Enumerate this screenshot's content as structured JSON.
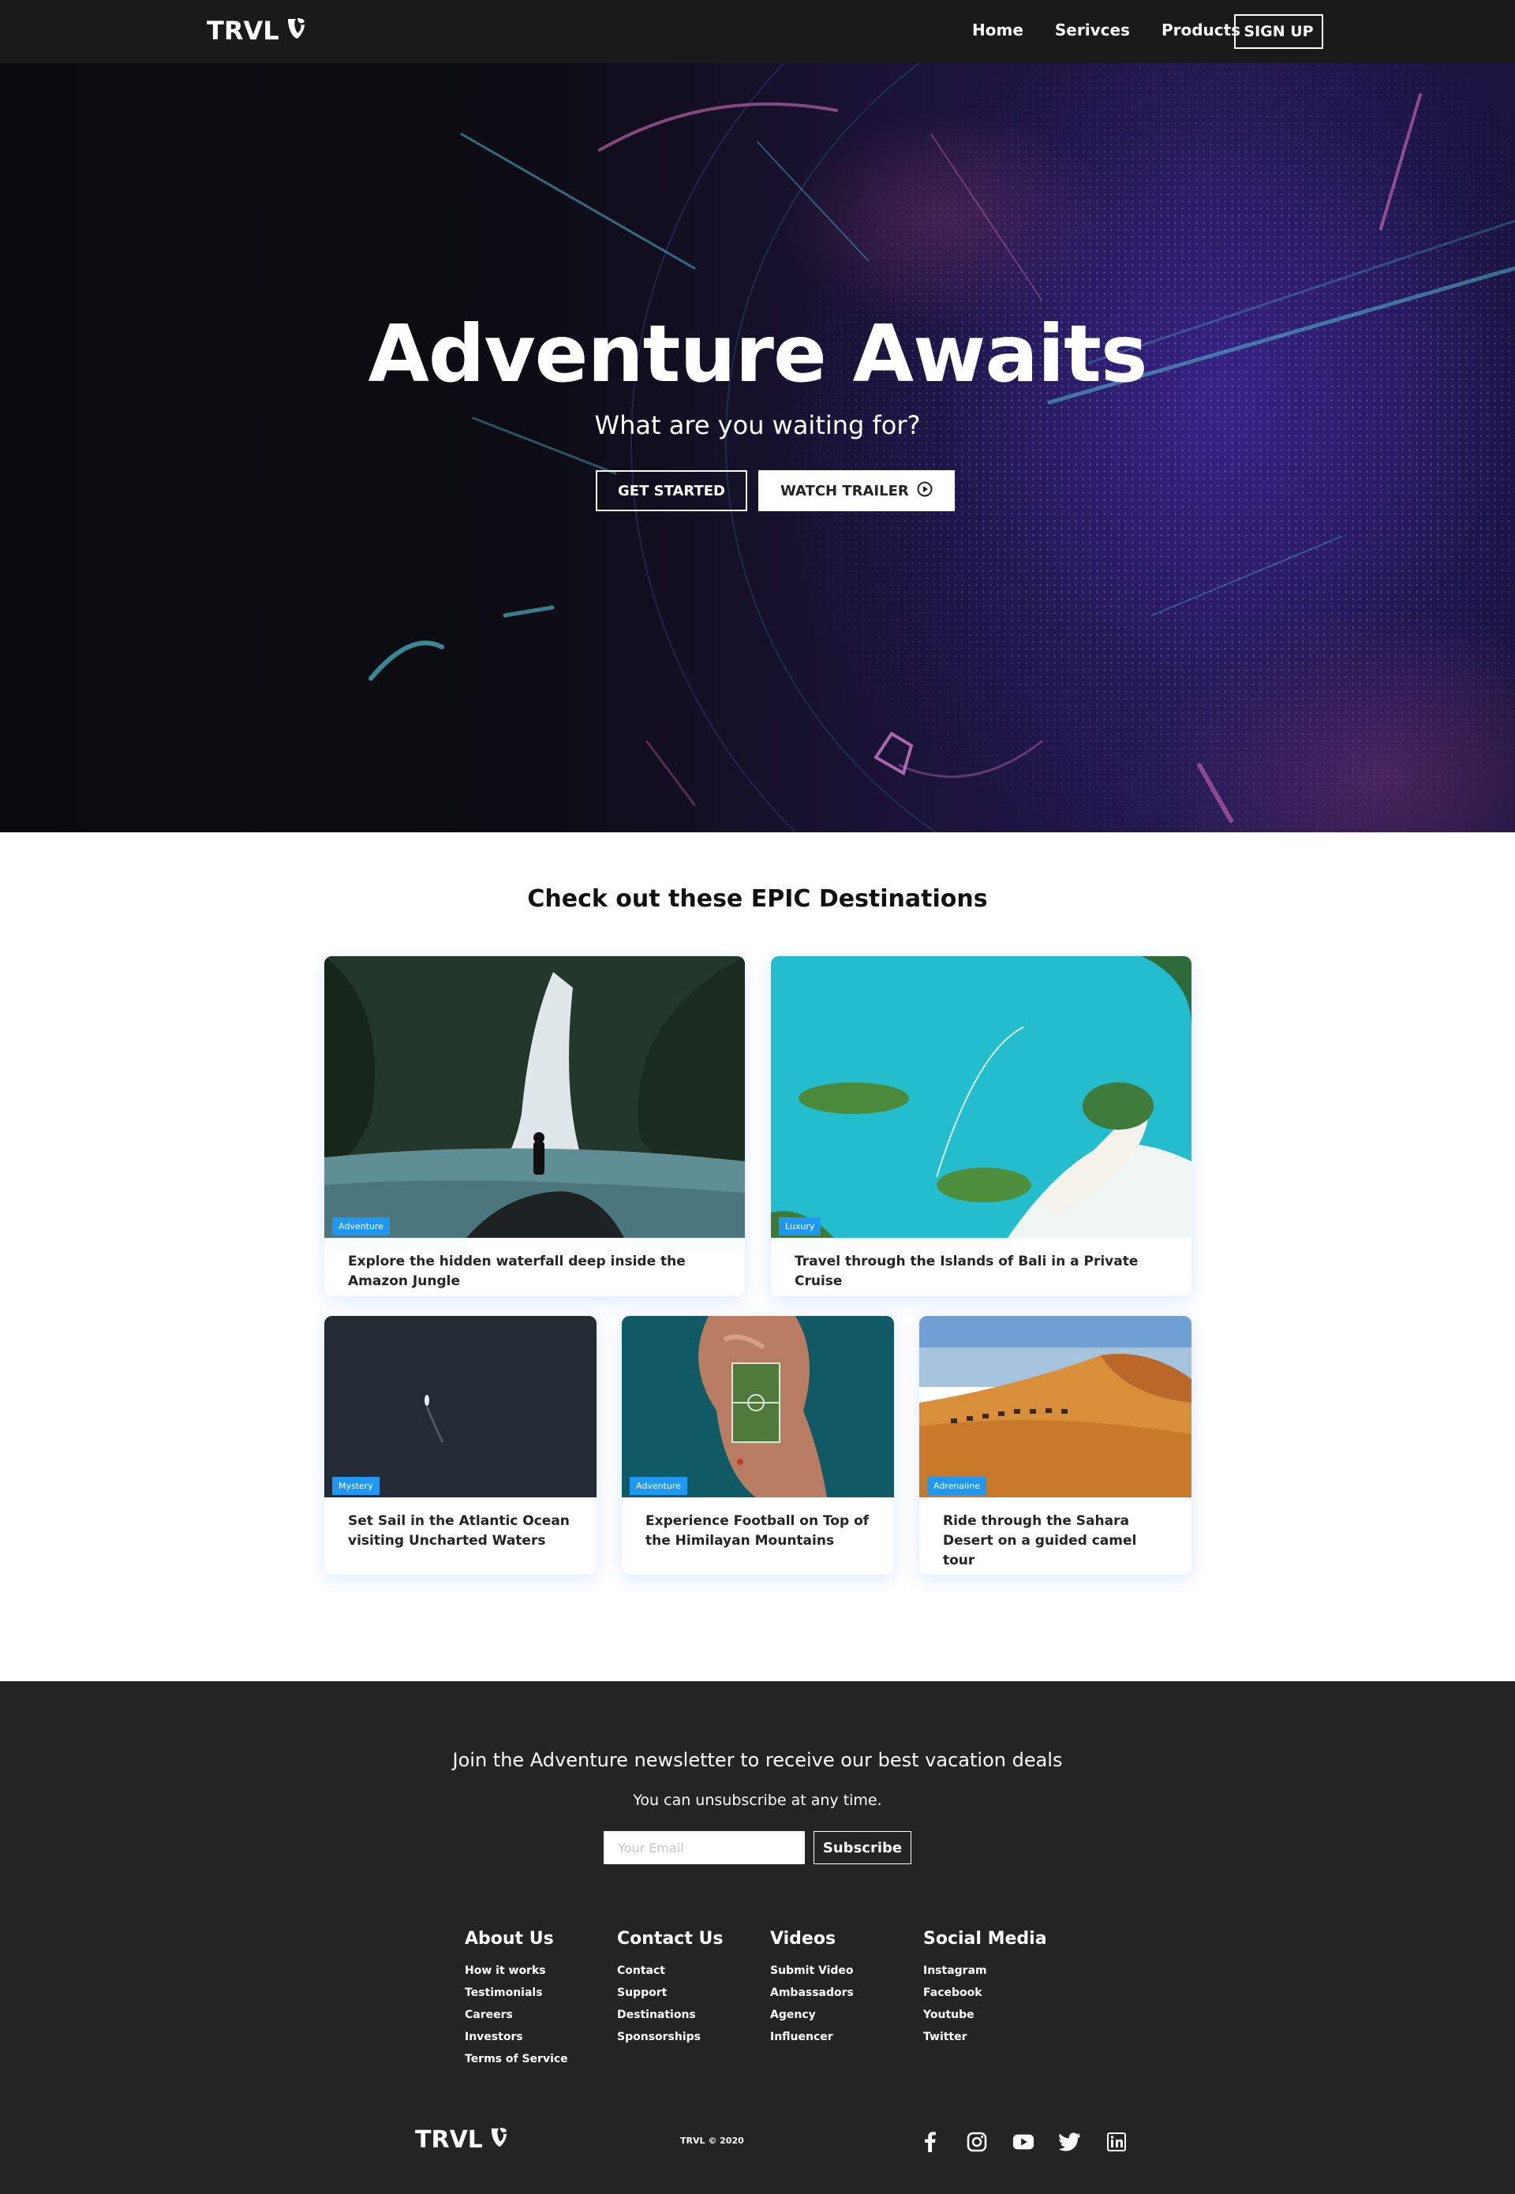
{
  "brand": {
    "name": "TRVL"
  },
  "nav": {
    "links": [
      "Home",
      "Serivces",
      "Products"
    ],
    "signup_label": "SIGN UP"
  },
  "hero": {
    "title": "Adventure Awaits",
    "subtitle": "What are you waiting for?",
    "get_started_label": "GET STARTED",
    "watch_trailer_label": "WATCH TRAILER",
    "watch_trailer_icon": "play-circle-icon"
  },
  "destinations": {
    "heading": "Check out these EPIC Destinations",
    "cards": [
      {
        "badge": "Adventure",
        "text": "Explore the hidden waterfall deep inside the Amazon Jungle"
      },
      {
        "badge": "Luxury",
        "text": "Travel through the Islands of Bali in a Private Cruise"
      },
      {
        "badge": "Mystery",
        "text": "Set Sail in the Atlantic Ocean visiting Uncharted Waters"
      },
      {
        "badge": "Adventure",
        "text": "Experience Football on Top of the Himilayan Mountains"
      },
      {
        "badge": "Adrenaline",
        "text": "Ride through the Sahara Desert on a guided camel tour"
      }
    ]
  },
  "newsletter": {
    "title": "Join the Adventure newsletter to receive our best vacation deals",
    "subtitle": "You can unsubscribe at any time.",
    "email_placeholder": "Your Email",
    "subscribe_label": "Subscribe"
  },
  "footer_columns": [
    {
      "title": "About Us",
      "links": [
        "How it works",
        "Testimonials",
        "Careers",
        "Investors",
        "Terms of Service"
      ]
    },
    {
      "title": "Contact Us",
      "links": [
        "Contact",
        "Support",
        "Destinations",
        "Sponsorships"
      ]
    },
    {
      "title": "Videos",
      "links": [
        "Submit Video",
        "Ambassadors",
        "Agency",
        "Influencer"
      ]
    },
    {
      "title": "Social Media",
      "links": [
        "Instagram",
        "Facebook",
        "Youtube",
        "Twitter"
      ]
    }
  ],
  "copyright": "TRVL © 2020",
  "social_icons": [
    "facebook-icon",
    "instagram-icon",
    "youtube-icon",
    "twitter-icon",
    "linkedin-icon"
  ],
  "colors": {
    "badge": "#1f98f4",
    "nav_bg": "#1a1a1a",
    "footer_bg": "#242424"
  }
}
